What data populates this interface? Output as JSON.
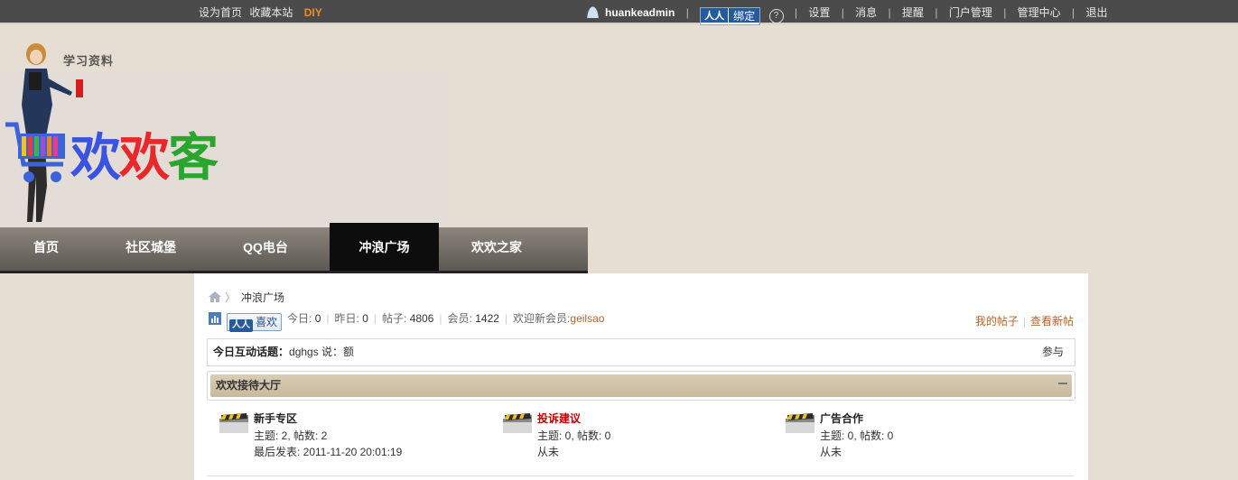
{
  "topbar": {
    "links_left": [
      "设为首页",
      "收藏本站"
    ],
    "diy": "DIY",
    "username": "huankeadmin",
    "bind_logo": "人人",
    "bind_label": "绑定",
    "help": "?",
    "menu": [
      "设置",
      "消息",
      "提醒",
      "门户管理",
      "管理中心",
      "退出"
    ]
  },
  "header": {
    "tagline": "学习资料",
    "brand": [
      "欢",
      "欢",
      "客"
    ]
  },
  "nav": {
    "items": [
      "首页",
      "社区城堡",
      "QQ电台",
      "冲浪广场",
      "欢欢之家"
    ],
    "active_index": 3
  },
  "breadcrumb": {
    "current": "冲浪广场"
  },
  "stats": {
    "like_logo": "人人",
    "like_label": "喜欢",
    "today_label": "今日:",
    "today": "0",
    "yesterday_label": "昨日:",
    "yesterday": "0",
    "posts_label": "帖子:",
    "posts": "4806",
    "members_label": "会员:",
    "members": "1422",
    "newest_label": "欢迎新会员:",
    "newest": "geilsao",
    "my_posts": "我的帖子",
    "new_posts": "查看新帖"
  },
  "topic": {
    "label": "今日互动话题：",
    "value": "dghgs 说：额",
    "join": "参与"
  },
  "category": {
    "title": "欢欢接待大厅"
  },
  "forums": [
    {
      "name": "新手专区",
      "hot": false,
      "stats": "主题: 2, 帖数: 2",
      "last": "最后发表: 2011-11-20 20:01:19"
    },
    {
      "name": "投诉建议",
      "hot": true,
      "stats": "主题: 0, 帖数: 0",
      "last": "从未"
    },
    {
      "name": "广告合作",
      "hot": false,
      "stats": "主题: 0, 帖数: 0",
      "last": "从未"
    }
  ],
  "colors": {
    "topbar_bg": "#4b4b4b",
    "diy": "#f08c1e",
    "brand_blue": "#3a53e0",
    "brand_red": "#e8282b",
    "brand_green": "#2aa62e",
    "link_orange": "#b8632a",
    "hot_red": "#c40000",
    "category_header": "#d8cdb6"
  }
}
